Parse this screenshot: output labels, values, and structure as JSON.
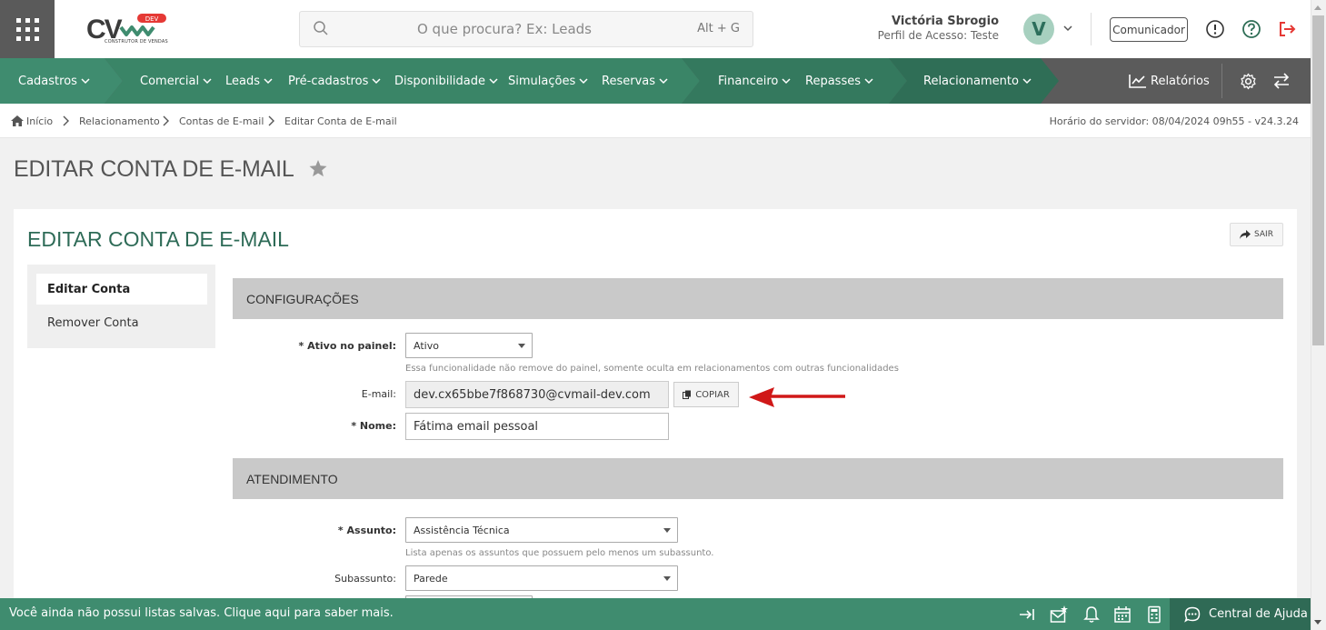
{
  "header": {
    "logo_text": "CV",
    "logo_badge": "DEV",
    "logo_subtitle": "CONSTRUTOR DE VENDAS",
    "search_placeholder": "O que procura? Ex: Leads",
    "search_shortcut": "Alt + G",
    "user_name": "Victória Sbrogio",
    "user_profile": "Perfil de Acesso: Teste",
    "avatar_letter": "V",
    "comunicador_label": "Comunicador"
  },
  "nav": {
    "items": [
      {
        "label": "Cadastros"
      },
      {
        "label": "Comercial"
      },
      {
        "label": "Leads"
      },
      {
        "label": "Pré-cadastros"
      },
      {
        "label": "Disponibilidade"
      },
      {
        "label": "Simulações"
      },
      {
        "label": "Reservas"
      },
      {
        "label": "Financeiro"
      },
      {
        "label": "Repasses"
      },
      {
        "label": "Relacionamento"
      }
    ],
    "reports_label": "Relatórios",
    "colors": {
      "green1": "#3f8c6f",
      "green2": "#367d62",
      "green3": "#2f6e56",
      "gray": "#5b5b5b"
    }
  },
  "breadcrumb": {
    "items": [
      "Início",
      "Relacionamento",
      "Contas de E-mail",
      "Editar Conta de E-mail"
    ],
    "server_time": "Horário do servidor: 08/04/2024 09h55 - v24.3.24"
  },
  "page": {
    "title": "EDITAR CONTA DE E-MAIL",
    "card_title": "EDITAR CONTA DE E-MAIL",
    "exit_label": "SAIR"
  },
  "sidemenu": {
    "items": [
      "Editar Conta",
      "Remover Conta"
    ]
  },
  "form": {
    "section_config": "CONFIGURAÇÕES",
    "active_label": "Ativo no painel:",
    "active_value": "Ativo",
    "active_help": "Essa funcionalidade não remove do painel, somente oculta em relacionamentos com outras funcionalidades",
    "email_label": "E-mail:",
    "email_value": "dev.cx65bbe7f868730@cvmail-dev.com",
    "copy_label": "COPIAR",
    "name_label": "Nome:",
    "name_value": "Fátima email pessoal",
    "section_atendimento": "ATENDIMENTO",
    "subject_label": "Assunto:",
    "subject_value": "Assistência Técnica",
    "subject_help": "Lista apenas os assuntos que possuem pelo menos um subassunto.",
    "subsubject_label": "Subassunto:",
    "subsubject_value": "Parede"
  },
  "footer": {
    "message": "Você ainda não possui listas salvas. Clique aqui para saber mais.",
    "help_center": "Central de Ajuda"
  }
}
